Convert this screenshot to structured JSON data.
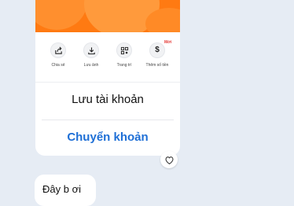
{
  "card": {
    "actions": [
      {
        "label": "Chia sẻ",
        "icon": "share-icon"
      },
      {
        "label": "Lưu ảnh",
        "icon": "download-icon"
      },
      {
        "label": "Trang trí",
        "icon": "qr-decorate-icon"
      },
      {
        "label": "Thêm số tiền",
        "icon": "dollar-icon",
        "badge": "Mới"
      }
    ],
    "save_account_label": "Lưu tài khoản",
    "transfer_label": "Chuyển khoản"
  },
  "message": {
    "text": "Đây b ơi"
  },
  "colors": {
    "banner": "#ff7a12",
    "transfer_link": "#1e6fd6",
    "background": "#e6ecf4",
    "badge": "#e53935"
  }
}
